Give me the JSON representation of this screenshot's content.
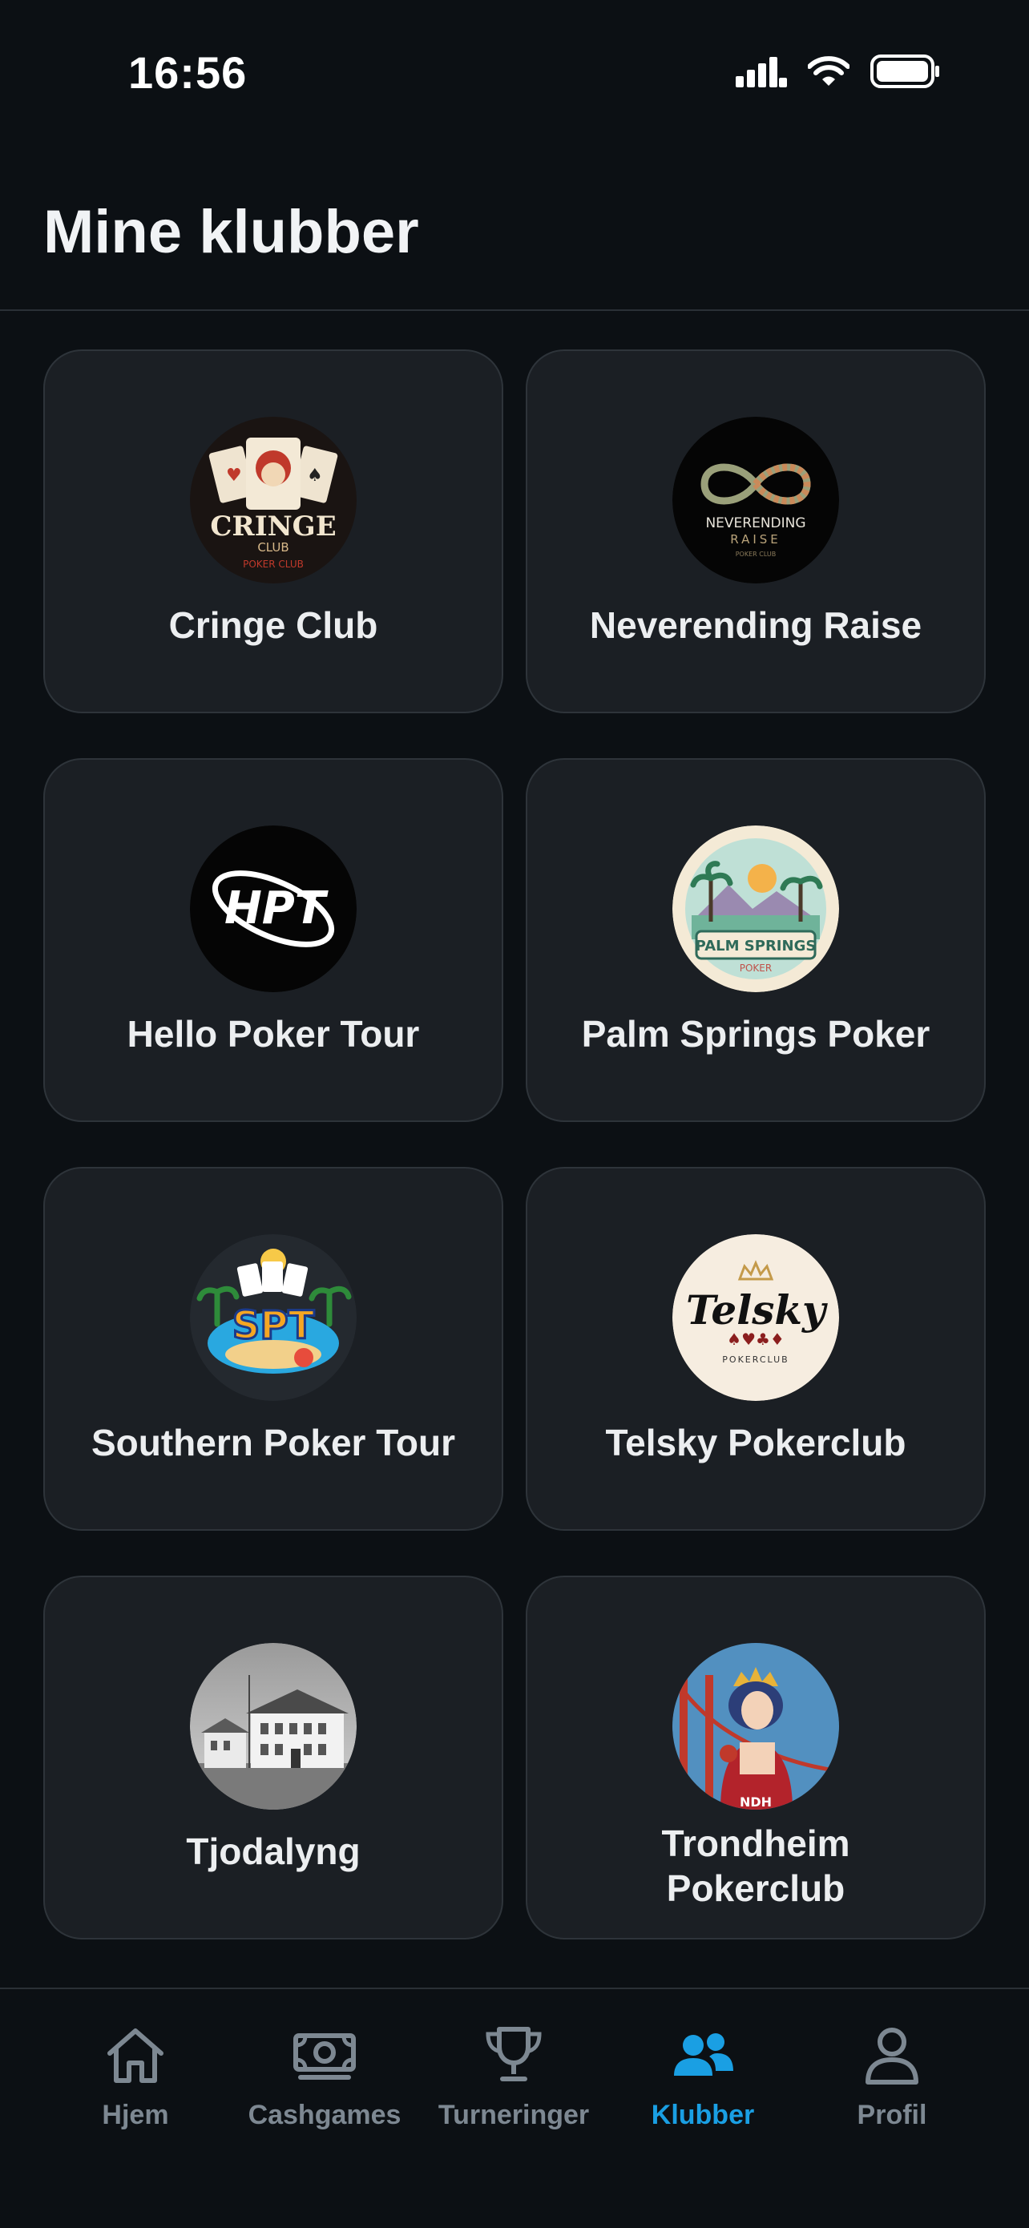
{
  "status_bar": {
    "time": "16:56"
  },
  "header": {
    "title": "Mine klubber"
  },
  "clubs": [
    {
      "name": "Cringe Club",
      "logo_text": "CRINGE",
      "logo_sub": "CLUB",
      "logo_sub2": "POKER CLUB"
    },
    {
      "name": "Neverending Raise",
      "logo_text": "NEVERENDING",
      "logo_sub": "RAISE",
      "logo_sub2": "POKER CLUB"
    },
    {
      "name": "Hello Poker Tour",
      "logo_text": "HPT"
    },
    {
      "name": "Palm Springs Poker",
      "logo_text": "PALM SPRINGS",
      "logo_sub": "POKER"
    },
    {
      "name": "Southern Poker Tour",
      "logo_text": "SPT"
    },
    {
      "name": "Telsky Pokerclub",
      "logo_text": "Telsky",
      "logo_sub": "POKERCLUB"
    },
    {
      "name": "Tjodalyng"
    },
    {
      "name": "Trondheim Pokerclub",
      "name_line1": "Trondheim",
      "name_line2": "Pokerclub"
    }
  ],
  "tabs": [
    {
      "label": "Hjem",
      "icon": "home-icon",
      "active": false
    },
    {
      "label": "Cashgames",
      "icon": "cash-icon",
      "active": false
    },
    {
      "label": "Turneringer",
      "icon": "trophy-icon",
      "active": false
    },
    {
      "label": "Klubber",
      "icon": "people-icon",
      "active": true
    },
    {
      "label": "Profil",
      "icon": "person-icon",
      "active": false
    }
  ],
  "colors": {
    "background": "#0c1014",
    "card": "#1b1f24",
    "accent": "#1a9fe3",
    "tab_inactive": "#7d8892"
  }
}
